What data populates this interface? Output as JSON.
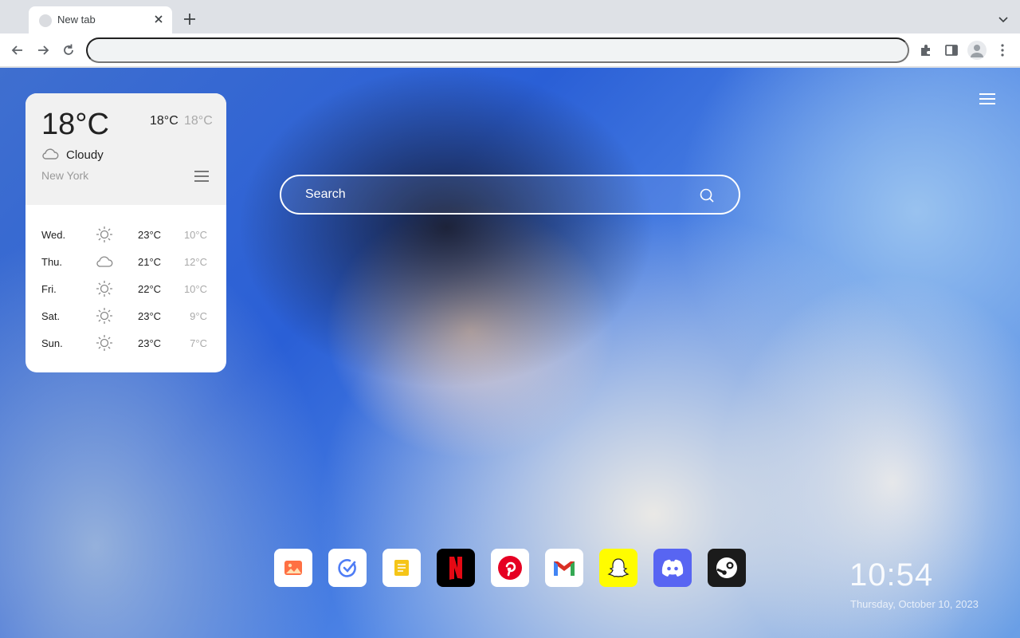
{
  "browser": {
    "tab": {
      "title": "New tab"
    },
    "omnibox": {
      "value": "",
      "placeholder": ""
    }
  },
  "weather": {
    "current_temp": "18°C",
    "high": "18°C",
    "low": "18°C",
    "condition": "Cloudy",
    "condition_icon": "cloud-icon",
    "city": "New York",
    "forecast": [
      {
        "day": "Wed.",
        "icon": "sun-icon",
        "high": "23°C",
        "low": "10°C"
      },
      {
        "day": "Thu.",
        "icon": "cloud-icon",
        "high": "21°C",
        "low": "12°C"
      },
      {
        "day": "Fri.",
        "icon": "sun-icon",
        "high": "22°C",
        "low": "10°C"
      },
      {
        "day": "Sat.",
        "icon": "sun-icon",
        "high": "23°C",
        "low": "9°C"
      },
      {
        "day": "Sun.",
        "icon": "sun-icon",
        "high": "23°C",
        "low": "7°C"
      }
    ]
  },
  "search": {
    "placeholder": "Search"
  },
  "dock": {
    "apps": [
      {
        "name": "photos",
        "icon": "photos-icon",
        "bg": "#ffffff",
        "accent": "#ff7043"
      },
      {
        "name": "task",
        "icon": "check-circle-icon",
        "bg": "#ffffff",
        "accent": "#4f7df5"
      },
      {
        "name": "notes",
        "icon": "notes-icon",
        "bg": "#ffffff",
        "accent": "#f5c518"
      },
      {
        "name": "netflix",
        "icon": "netflix-icon",
        "bg": "#000000",
        "accent": "#e50914"
      },
      {
        "name": "pinterest",
        "icon": "pinterest-icon",
        "bg": "#ffffff",
        "accent": "#e60023"
      },
      {
        "name": "gmail",
        "icon": "gmail-icon",
        "bg": "#ffffff",
        "accent": "#d93025"
      },
      {
        "name": "snapchat",
        "icon": "snapchat-icon",
        "bg": "#fffc00",
        "accent": "#ffffff"
      },
      {
        "name": "discord",
        "icon": "discord-icon",
        "bg": "#5865f2",
        "accent": "#ffffff"
      },
      {
        "name": "steam",
        "icon": "steam-icon",
        "bg": "#1b1b1b",
        "accent": "#ffffff"
      }
    ]
  },
  "clock": {
    "time": "10:54",
    "date": "Thursday, October 10, 2023"
  }
}
